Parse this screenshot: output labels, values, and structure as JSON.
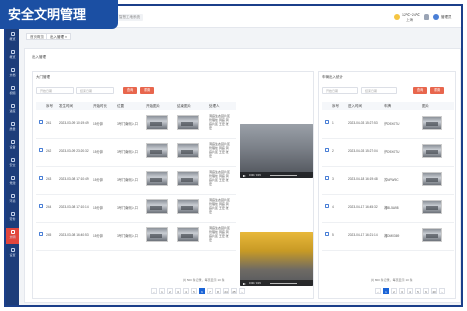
{
  "banner": {
    "title": "安全文明管理"
  },
  "topbar": {
    "system_tab": "智慧工地系统",
    "weather": {
      "temp": "12℃~24℃",
      "city": "上海"
    },
    "user_name": "管理员"
  },
  "sidebar": {
    "items": [
      {
        "label": "概览"
      },
      {
        "label": "概览"
      },
      {
        "label": "文档"
      },
      {
        "label": "视频"
      },
      {
        "label": "进度"
      },
      {
        "label": "质量"
      },
      {
        "label": "设备"
      },
      {
        "label": "安全"
      },
      {
        "label": "党建"
      },
      {
        "label": "环境"
      },
      {
        "label": "劳务"
      },
      {
        "label": "文明"
      },
      {
        "label": "设置"
      }
    ]
  },
  "breadcrumbs": [
    "首页概览",
    "出入管理 ×"
  ],
  "content": {
    "title": "出入管理"
  },
  "left_panel": {
    "title": "大门管理",
    "filter_start_placeholder": "开始日期",
    "filter_end_placeholder": "结束日期",
    "search_label": "查询",
    "reset_label": "重置",
    "columns": [
      "序号",
      "发生时间",
      "开始时长",
      "位置",
      "开始图片",
      "结束图片",
      "处理人"
    ],
    "rows": [
      {
        "id": "241",
        "time": "2023-03-09 10:19:49",
        "duration": "15分钟",
        "location": "3号门南侧入口",
        "handler": "洞庭生态园片区管理处 洞庭 洞庭片区 王宏 张宏"
      },
      {
        "id": "242",
        "time": "2023-03-09 23:20:32",
        "duration": "15分钟",
        "location": "3号门南侧入口",
        "handler": "洞庭生态园片区管理处 洞庭 洞庭片区 王宏 张宏"
      },
      {
        "id": "243",
        "time": "2023-03-08 17:10:49",
        "duration": "15分钟",
        "location": "3号门南侧入口",
        "handler": "洞庭生态园片区管理处 洞庭 洞庭片区 王宏 张宏"
      },
      {
        "id": "244",
        "time": "2023-03-08 17:10:14",
        "duration": "15分钟",
        "location": "3号门南侧入口",
        "handler": "洞庭生态园片区管理处 洞庭 洞庭片区 王宏 张宏"
      },
      {
        "id": "245",
        "time": "2023-03-08 16:40:53",
        "duration": "15分钟",
        "location": "3号门南侧入口",
        "handler": "洞庭生态园片区管理处 洞庭 洞庭片区 王宏 张宏"
      }
    ],
    "video1_time": "0:00 / 0:15",
    "video2_time": "0:00 / 0:15",
    "pager": {
      "pages": [
        "1",
        "2",
        "3",
        "4",
        "5",
        "6",
        "7",
        "8",
        "24",
        "25"
      ],
      "prev": "‹",
      "next": "›",
      "active_page": "6",
      "info": "共 500 条记录，每页显示 10 条"
    }
  },
  "right_panel": {
    "title": "车辆出入统计",
    "filter_start_placeholder": "开始日期",
    "filter_end_placeholder": "结束日期",
    "search_label": "查询",
    "reset_label": "重置",
    "columns": [
      "序号",
      "进入时间",
      "车牌",
      "图片"
    ],
    "rows": [
      {
        "id": "1",
        "time": "2023-04-03 15:27:53",
        "plate": "沪D9X0TU"
      },
      {
        "id": "2",
        "time": "2023-04-03 15:27:04",
        "plate": "沪D9X0TU"
      },
      {
        "id": "3",
        "time": "2023-04-18 16:19:48",
        "plate": "苏NFW9C"
      },
      {
        "id": "4",
        "time": "2023-04-17 16:45:32",
        "plate": "湘BL5A98"
      },
      {
        "id": "5",
        "time": "2023-04-17 16:21:14",
        "plate": "湘DM0369"
      }
    ],
    "pager": {
      "pages": [
        "1",
        "2",
        "3",
        "4",
        "5",
        "6",
        "40"
      ],
      "prev": "‹",
      "next": "›",
      "active_page": "1",
      "info": "共 800 条记录，每页显示 10 条"
    }
  },
  "colors": {
    "brand": "#1b4fa3",
    "sidebar": "#1d3d7a",
    "active_nav": "#e2463c",
    "button": "#e8664d",
    "pager_active": "#1b64d6"
  }
}
